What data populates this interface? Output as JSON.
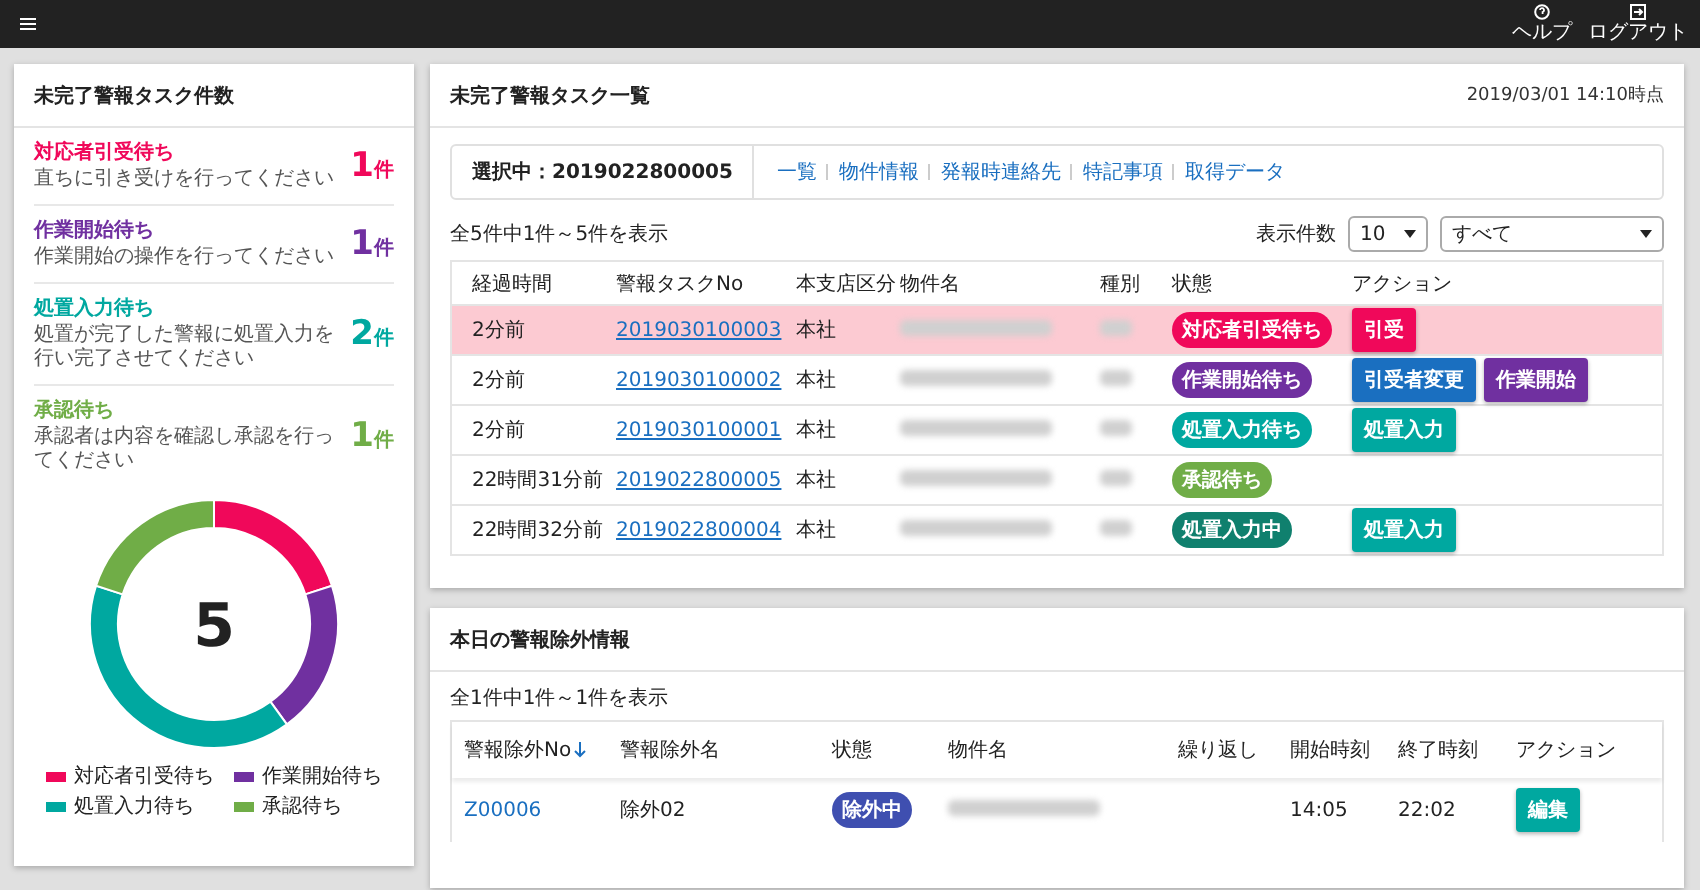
{
  "topbar": {
    "actions": [
      {
        "kind": "help",
        "label": "ヘルプ"
      },
      {
        "kind": "logout",
        "label": "ログアウト"
      }
    ]
  },
  "summary": {
    "title": "未完了警報タスク件数",
    "items": [
      {
        "label": "対応者引受待ち",
        "description": "直ちに引き受けを行ってください",
        "count": "1",
        "unit": "件",
        "color": "#f0085a"
      },
      {
        "label": "作業開始待ち",
        "description": "作業開始の操作を行ってください",
        "count": "1",
        "unit": "件",
        "color": "#7030a0"
      },
      {
        "label": "処置入力待ち",
        "description": "処置が完了した警報に処置入力を行い完了させてください",
        "count": "2",
        "unit": "件",
        "color": "#00a8a0"
      },
      {
        "label": "承認待ち",
        "description": "承認者は内容を確認し承認を行ってください",
        "count": "1",
        "unit": "件",
        "color": "#70ad47"
      }
    ],
    "total": "5",
    "chart_data": {
      "type": "donut",
      "categories": [
        "対応者引受待ち",
        "作業開始待ち",
        "処置入力待ち",
        "承認待ち"
      ],
      "values": [
        20,
        20,
        40,
        20
      ]
    }
  },
  "tasks": {
    "title": "未完了警報タスク一覧",
    "timestamp": "2019/03/01 14:10時点",
    "selected": "選択中：2019022800005",
    "nav": [
      "一覧",
      "物件情報",
      "発報時連絡先",
      "特記事項",
      "取得データ"
    ],
    "count_text": "全5件中1件～5件を表示",
    "page_size_label": "表示件数",
    "page_size": "10",
    "filter": "すべて",
    "columns": [
      "経過時間",
      "警報タスクNo",
      "本支店区分",
      "物件名",
      "種別",
      "状態",
      "アクション"
    ],
    "rows": [
      {
        "elapsed": "2分前",
        "task_no": "2019030100003",
        "branch": "本社",
        "highlighted": true,
        "status": {
          "kind": "accept_wait",
          "label": "対応者引受待ち"
        },
        "actions": [
          {
            "kind": "accept",
            "label": "引受"
          }
        ]
      },
      {
        "elapsed": "2分前",
        "task_no": "2019030100002",
        "branch": "本社",
        "highlighted": false,
        "status": {
          "kind": "start_wait",
          "label": "作業開始待ち"
        },
        "actions": [
          {
            "kind": "change",
            "label": "引受者変更"
          },
          {
            "kind": "start",
            "label": "作業開始"
          }
        ]
      },
      {
        "elapsed": "2分前",
        "task_no": "2019030100001",
        "branch": "本社",
        "highlighted": false,
        "status": {
          "kind": "input_wait",
          "label": "処置入力待ち"
        },
        "actions": [
          {
            "kind": "input",
            "label": "処置入力"
          }
        ]
      },
      {
        "elapsed": "22時間31分前",
        "task_no": "2019022800005",
        "branch": "本社",
        "highlighted": false,
        "status": {
          "kind": "approval_wait",
          "label": "承認待ち"
        },
        "actions": []
      },
      {
        "elapsed": "22時間32分前",
        "task_no": "2019022800004",
        "branch": "本社",
        "highlighted": false,
        "status": {
          "kind": "inputting",
          "label": "処置入力中"
        },
        "actions": [
          {
            "kind": "input",
            "label": "処置入力"
          }
        ]
      }
    ]
  },
  "exclusions": {
    "title": "本日の警報除外情報",
    "count_text": "全1件中1件～1件を表示",
    "columns": [
      {
        "label": "警報除外No",
        "sorted": true
      },
      {
        "label": "警報除外名",
        "sorted": false
      },
      {
        "label": "状態",
        "sorted": false
      },
      {
        "label": "物件名",
        "sorted": false
      },
      {
        "label": "繰り返し",
        "sorted": false
      },
      {
        "label": "開始時刻",
        "sorted": false
      },
      {
        "label": "終了時刻",
        "sorted": false
      },
      {
        "label": "アクション",
        "sorted": false
      }
    ],
    "rows": [
      {
        "no": "Z00006",
        "name": "除外02",
        "status": {
          "kind": "excluded",
          "label": "除外中"
        },
        "start": "14:05",
        "end": "22:02",
        "actions": [
          {
            "kind": "edit",
            "label": "編集"
          }
        ]
      }
    ]
  }
}
